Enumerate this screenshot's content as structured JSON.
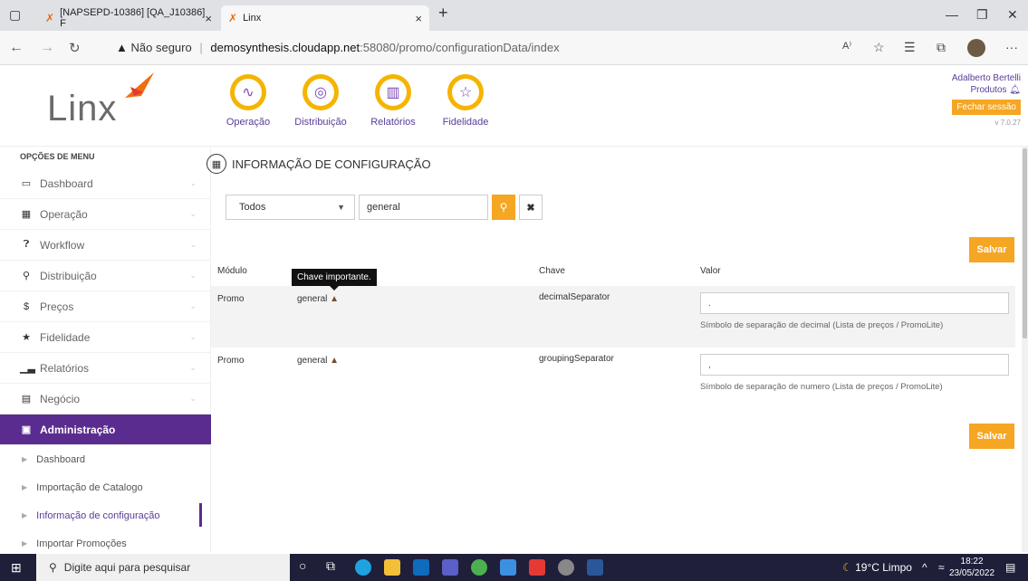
{
  "browser": {
    "tabs": [
      {
        "title": "[NAPSEPD-10386] [QA_J10386] F"
      },
      {
        "title": "Linx"
      }
    ],
    "security_label": "Não seguro",
    "url_host": "demosynthesis.cloudapp.net",
    "url_path": ":58080/promo/configurationData/index"
  },
  "header": {
    "logo_text": "Linx",
    "modules": [
      {
        "label": "Operação",
        "icon": "graph-icon"
      },
      {
        "label": "Distribuição",
        "icon": "location-pin-icon"
      },
      {
        "label": "Relatórios",
        "icon": "bar-chart-icon"
      },
      {
        "label": "Fidelidade",
        "icon": "star-icon"
      }
    ],
    "user_name": "Adalberto Bertelli",
    "user_context": "Produtos",
    "logout_label": "Fechar sessão",
    "version": "v 7.0.27"
  },
  "sidebar": {
    "heading": "OPÇÕES DE MENU",
    "items": [
      {
        "label": "Dashboard",
        "icon": "monitor-icon"
      },
      {
        "label": "Operação",
        "icon": "grid-icon"
      },
      {
        "label": "Workflow",
        "icon": "question-icon"
      },
      {
        "label": "Distribuição",
        "icon": "pin-icon"
      },
      {
        "label": "Preços",
        "icon": "dollar-icon"
      },
      {
        "label": "Fidelidade",
        "icon": "star-icon"
      },
      {
        "label": "Relatórios",
        "icon": "bar-chart-icon"
      },
      {
        "label": "Negócio",
        "icon": "building-icon"
      },
      {
        "label": "Administração",
        "icon": "calendar-icon"
      }
    ],
    "subitems": [
      {
        "label": "Dashboard"
      },
      {
        "label": "Importação de Catalogo"
      },
      {
        "label": "Informação de configuração"
      },
      {
        "label": "Importar Promoções"
      }
    ]
  },
  "main": {
    "title": "INFORMAÇÃO DE CONFIGURAÇÃO",
    "filter_select": "Todos",
    "search_value": "general",
    "save_label": "Salvar",
    "columns": [
      "Módulo",
      "Chave",
      "Valor"
    ],
    "tooltip": "Chave importante.",
    "rows": [
      {
        "module": "Promo",
        "group": "general",
        "key": "decimalSeparator",
        "value": ".",
        "description": "Símbolo de separação de decimal (Lista de preços / PromoLite)"
      },
      {
        "module": "Promo",
        "group": "general",
        "key": "groupingSeparator",
        "value": ",",
        "description": "Símbolo de separação de numero (Lista de preços / PromoLite)"
      }
    ]
  },
  "taskbar": {
    "search_placeholder": "Digite aqui para pesquisar",
    "weather": "19°C Limpo",
    "time": "18:22",
    "date": "23/05/2022"
  },
  "colors": {
    "accent": "#f5a623",
    "brand_purple": "#5b2c8f"
  }
}
